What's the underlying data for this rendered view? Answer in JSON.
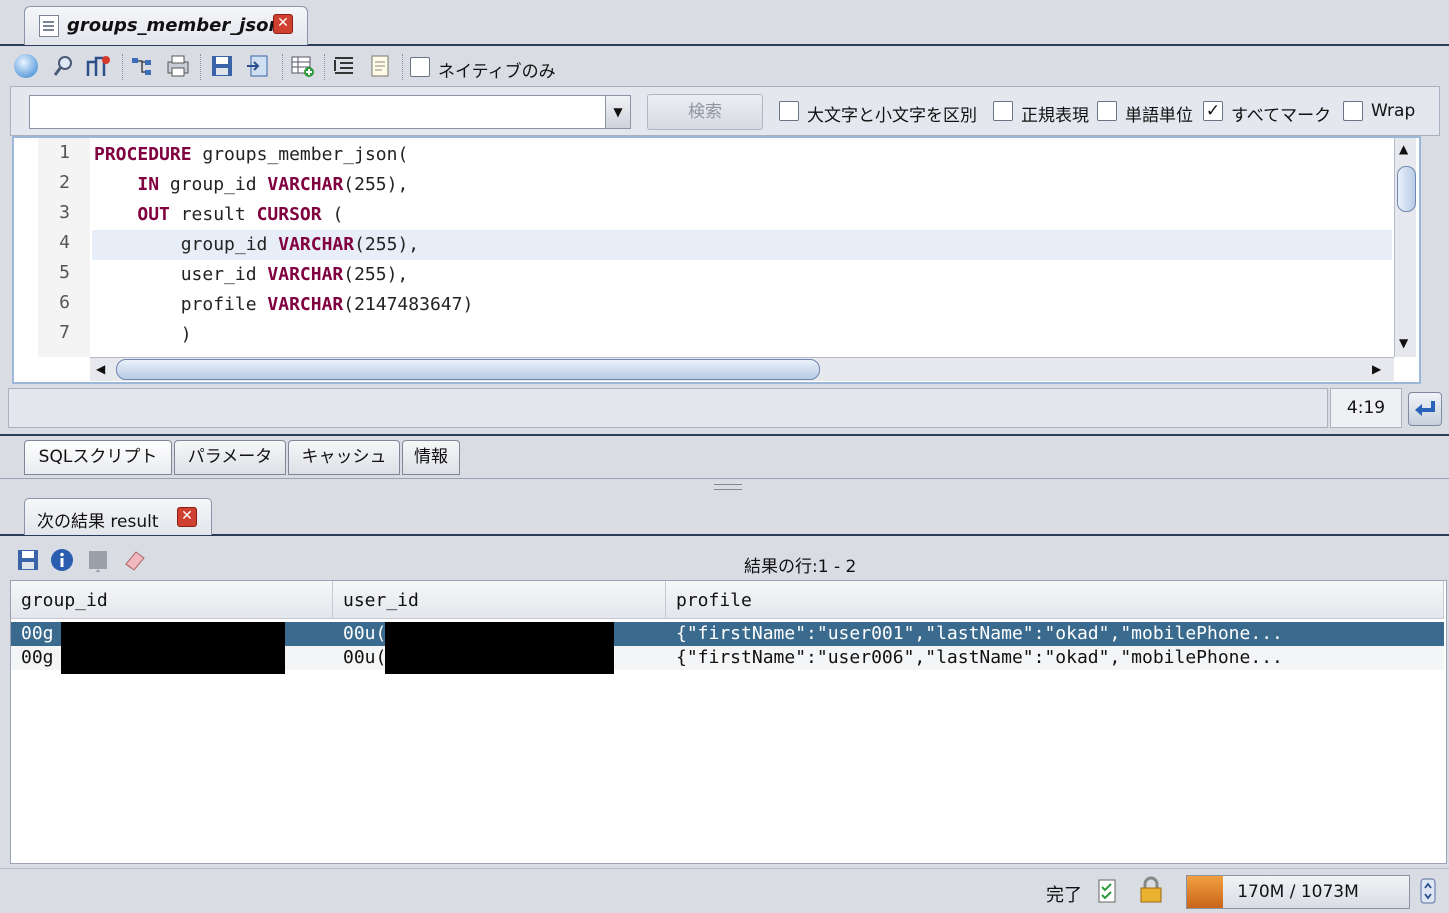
{
  "editor_tab": {
    "title": "groups_member_json",
    "close_icon": "close-icon"
  },
  "toolbar": {
    "icons": [
      "run-icon",
      "search-icon",
      "explain-icon",
      "tree-icon",
      "print-icon",
      "save-icon",
      "export-icon",
      "add-table-icon",
      "format-icon",
      "document-icon"
    ],
    "native_only_label": "ネイティブのみ",
    "native_only_checked": false
  },
  "search": {
    "query": "",
    "search_button": "検索",
    "options": [
      {
        "label": "大文字と小文字を区別",
        "checked": false
      },
      {
        "label": "正規表現",
        "checked": false
      },
      {
        "label": "単語単位",
        "checked": false
      },
      {
        "label": "すべてマーク",
        "checked": true
      },
      {
        "label": "Wrap",
        "checked": false
      }
    ]
  },
  "editor": {
    "line_numbers": [
      "1",
      "2",
      "3",
      "4",
      "5",
      "6",
      "7"
    ],
    "current_line": 4,
    "cursor_position": "4:19"
  },
  "bottom_tabs": [
    "SQLスクリプト",
    "パラメータ",
    "キャッシュ",
    "情報"
  ],
  "results": {
    "tab_title": "次の結果 result",
    "row_count": "結果の行:1 - 2",
    "columns": [
      "group_id",
      "user_id",
      "profile"
    ],
    "rows": [
      {
        "group_id": "00g",
        "user_id": "00u(",
        "profile": "{\"firstName\":\"user001\",\"lastName\":\"okad\",\"mobilePhone..."
      },
      {
        "group_id": "00g",
        "user_id": "00u(",
        "profile": "{\"firstName\":\"user006\",\"lastName\":\"okad\",\"mobilePhone..."
      }
    ],
    "selected_row": 0
  },
  "status": {
    "state": "完了",
    "memory": "170M / 1073M",
    "memory_fraction": 0.16
  },
  "colors": {
    "keyword": "#800040",
    "selection": "#3b6a8f",
    "current_line": "#e8eef8"
  }
}
